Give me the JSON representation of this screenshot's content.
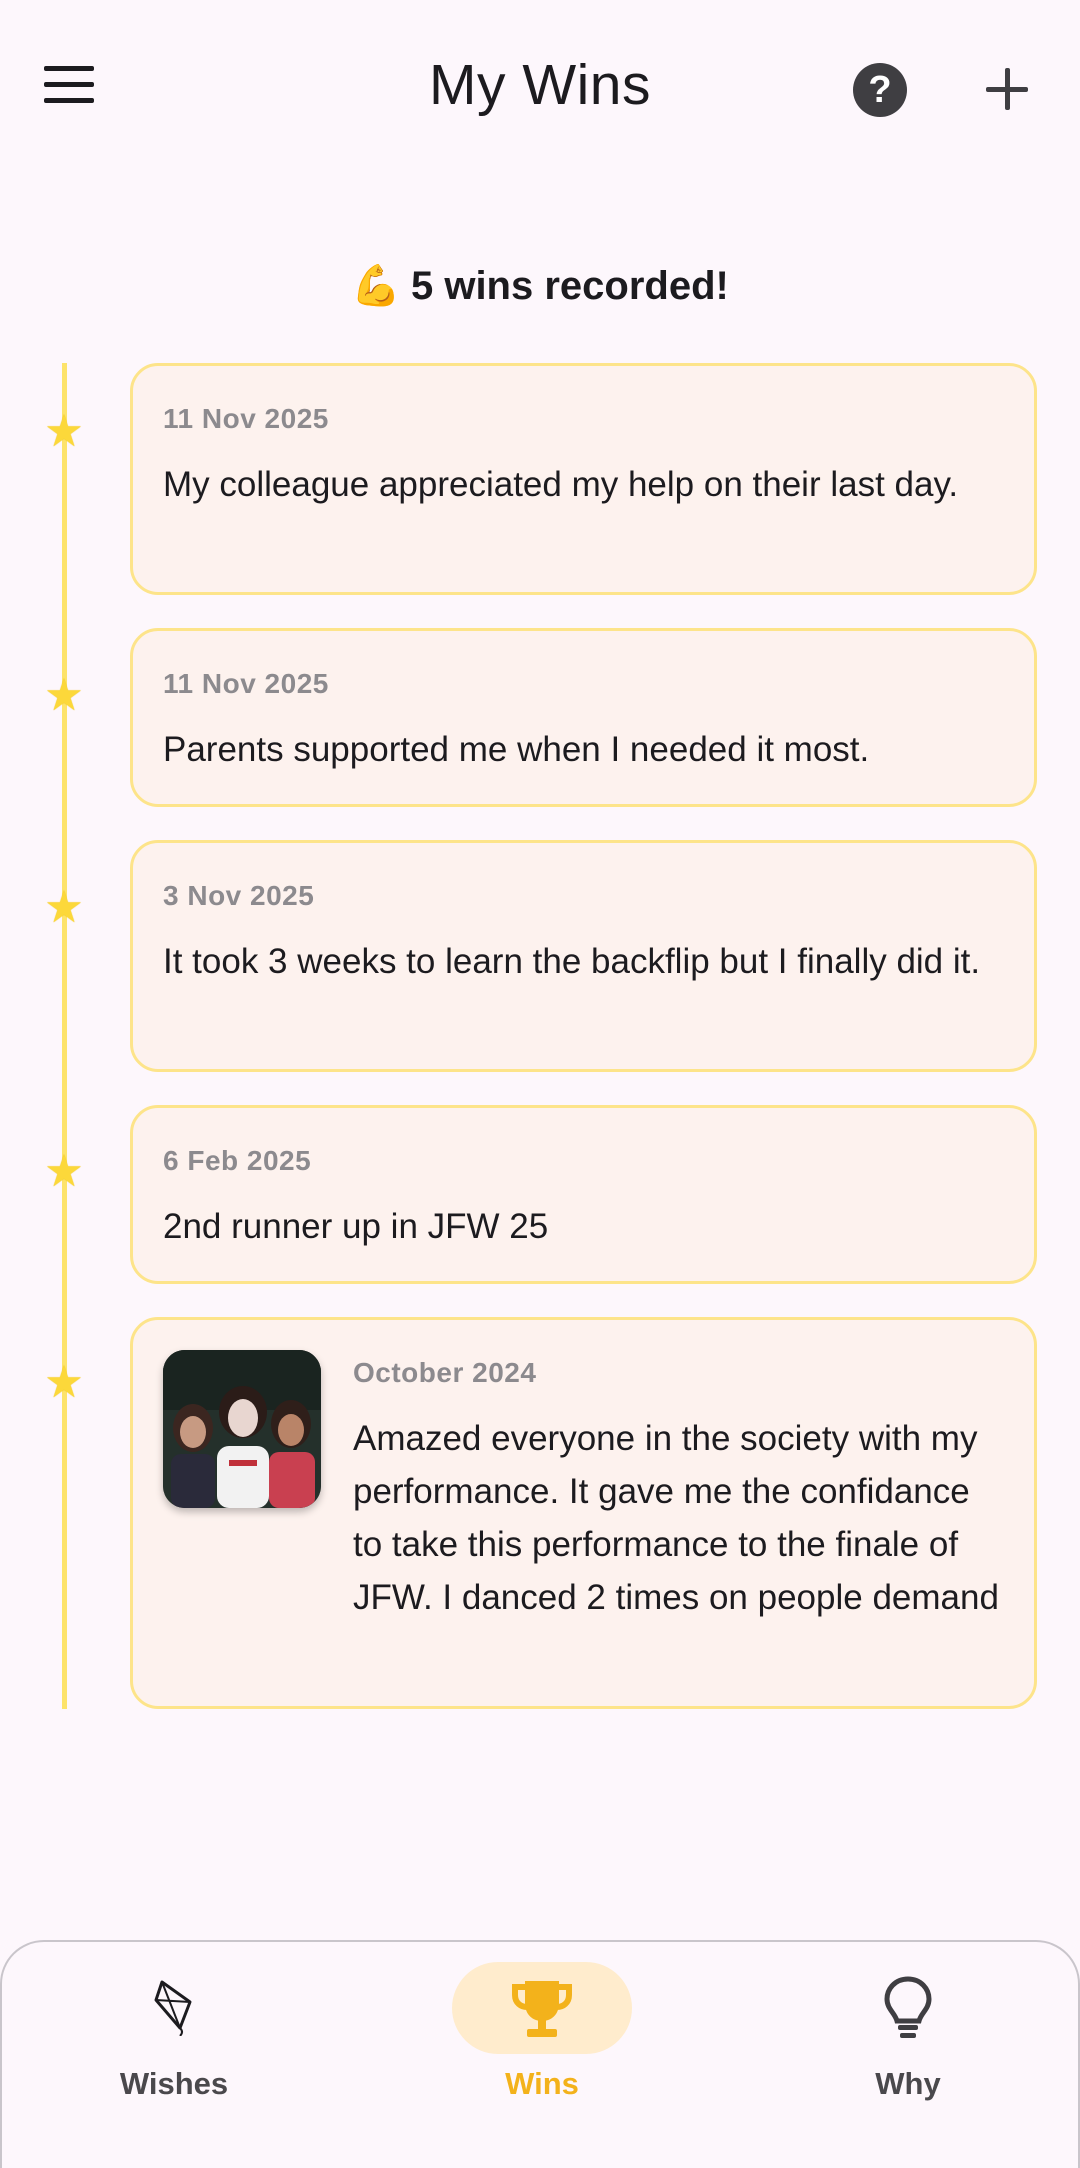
{
  "header": {
    "title": "My Wins"
  },
  "summary": {
    "emoji": "💪",
    "text": "5 wins recorded!"
  },
  "wins": [
    {
      "date": "11 Nov 2025",
      "text": "My colleague appreciated my help on their last day."
    },
    {
      "date": "11 Nov 2025",
      "text": "Parents supported me when I needed it most."
    },
    {
      "date": "3 Nov 2025",
      "text": "It took 3 weeks to learn the backflip but I finally did it."
    },
    {
      "date": "6 Feb 2025",
      "text": "2nd runner up in JFW 25"
    },
    {
      "date": "October 2024",
      "text": "Amazed everyone in the society with my performance. It gave me the confidance to take this performance to the finale of JFW. I danced 2 times on people demand",
      "has_photo": true
    }
  ],
  "nav": {
    "items": [
      {
        "label": "Wishes",
        "icon": "kite-icon",
        "active": false
      },
      {
        "label": "Wins",
        "icon": "trophy-icon",
        "active": true
      },
      {
        "label": "Why",
        "icon": "lightbulb-icon",
        "active": false
      }
    ]
  },
  "colors": {
    "background": "#fdf7fc",
    "card_background": "#fdf2ee",
    "card_border": "#fde48a",
    "timeline": "#fde36a",
    "accent": "#f3b21b",
    "active_nav_pill": "#ffeccd"
  }
}
